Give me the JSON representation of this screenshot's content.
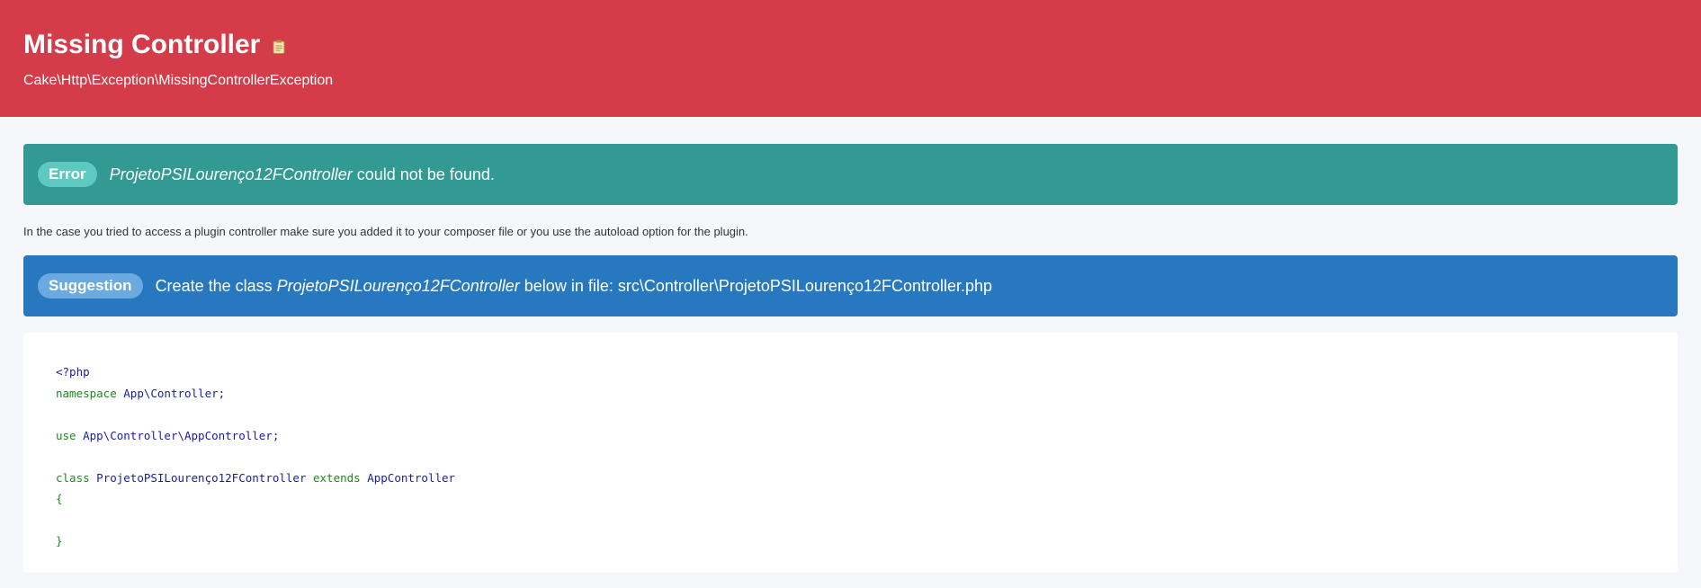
{
  "header": {
    "title": "Missing Controller",
    "exception": "Cake\\Http\\Exception\\MissingControllerException"
  },
  "error_alert": {
    "badge": "Error",
    "class_name": "ProjetoPSILourenço12FController",
    "message": " could not be found."
  },
  "note": "In the case you tried to access a plugin controller make sure you added it to your composer file or you use the autoload option for the plugin.",
  "suggestion_alert": {
    "badge": "Suggestion",
    "prefix": "Create the class ",
    "class_name": "ProjetoPSILourenço12FController",
    "suffix": " below in file: src\\Controller\\ProjetoPSILourenço12FController.php"
  },
  "code": {
    "php_open": "<?php",
    "ns_kw": "namespace",
    "ns_val": "App\\Controller;",
    "use_kw": "use",
    "use_val": "App\\Controller\\AppController;",
    "class_kw": "class",
    "class_name": "ProjetoPSILourenço12FController",
    "extends_kw": "extends",
    "parent": "AppController",
    "open_brace": "{",
    "close_brace": "}"
  },
  "colors": {
    "header_bg": "#d33c48",
    "error_bg": "#339a93",
    "suggestion_bg": "#2878bf",
    "page_bg": "#f5f7fa"
  },
  "icons": {
    "copy": "clipboard-icon"
  }
}
